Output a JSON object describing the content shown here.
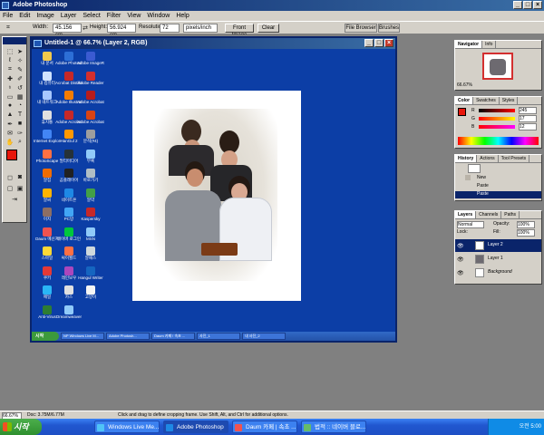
{
  "app": {
    "title": "Adobe Photoshop"
  },
  "menu": [
    "File",
    "Edit",
    "Image",
    "Layer",
    "Select",
    "Filter",
    "View",
    "Window",
    "Help"
  ],
  "options": {
    "width_label": "Width:",
    "width_value": "45.156 cm",
    "height_label": "Height:",
    "height_value": "56.924 cm",
    "resolution_label": "Resolution:",
    "resolution_value": "72",
    "units_value": "pixels/inch",
    "front_image_label": "Front Image",
    "clear_label": "Clear",
    "file_browser_label": "File Browser",
    "brushes_label": "Brushes"
  },
  "document": {
    "title": "Untitled-1 @ 66.7% (Layer 2, RGB)",
    "desktop_icons": [
      {
        "label": "내 문서",
        "color": "#f2c94c"
      },
      {
        "label": "Adobe Photosh",
        "color": "#2d6fd6"
      },
      {
        "label": "Adobe ImageR",
        "color": "#3b5bd1"
      },
      {
        "label": "내 컴퓨터",
        "color": "#cfe2ff"
      },
      {
        "label": "Acrobat Distiller",
        "color": "#c62828"
      },
      {
        "label": "Adobe Reader",
        "color": "#d32f2f"
      },
      {
        "label": "내 네트워크",
        "color": "#a7c7ff"
      },
      {
        "label": "Adobe Illustrat",
        "color": "#f57c00"
      },
      {
        "label": "Adobe Acrobat",
        "color": "#b71c1c"
      },
      {
        "label": "휴지통",
        "color": "#e0e0e0"
      },
      {
        "label": "Adobe Acrobat",
        "color": "#c62828"
      },
      {
        "label": "Adobe Acrobat",
        "color": "#d84315"
      },
      {
        "label": "Internet Explorer",
        "color": "#4285f4"
      },
      {
        "label": "HanGul 2",
        "color": "#ff9800"
      },
      {
        "label": "분석(#4)",
        "color": "#9e9e9e"
      },
      {
        "label": "PhotoScape",
        "color": "#ff7043"
      },
      {
        "label": "멀티미디어",
        "color": "#263238"
      },
      {
        "label": "부록",
        "color": "#90caf9"
      },
      {
        "label": "알집",
        "color": "#ef6c00"
      },
      {
        "label": "곰플레이어",
        "color": "#212121"
      },
      {
        "label": "바로가기",
        "color": "#b0bec5"
      },
      {
        "label": "알씨",
        "color": "#ffb300"
      },
      {
        "label": "네이트온",
        "color": "#1e88e5"
      },
      {
        "label": "알약",
        "color": "#43a047"
      },
      {
        "label": "이지",
        "color": "#8d6e63"
      },
      {
        "label": "PC방",
        "color": "#42a5f5"
      },
      {
        "label": "Kaspersky",
        "color": "#c62828"
      },
      {
        "label": "Daum 메신저",
        "color": "#ef5350"
      },
      {
        "label": "네이버 로그인",
        "color": "#00c73c"
      },
      {
        "label": "MSN",
        "color": "#90caf9"
      },
      {
        "label": "스마일",
        "color": "#fdd835"
      },
      {
        "label": "싸이월드",
        "color": "#ff7043"
      },
      {
        "label": "알패스",
        "color": "#cfd8dc"
      },
      {
        "label": "쿠키",
        "color": "#e53935"
      },
      {
        "label": "레인보우",
        "color": "#ab47bc"
      },
      {
        "label": "Hangul Writer",
        "color": "#1565c0"
      },
      {
        "label": "메일",
        "color": "#29b6f6"
      },
      {
        "label": "카스",
        "color": "#e0e0e0"
      },
      {
        "label": "고양이",
        "color": "#f5f5f5"
      },
      {
        "label": "Anti-Virus",
        "color": "#2e7d32"
      },
      {
        "label": "Dreamweaver",
        "color": "#90caf9"
      }
    ],
    "inner_taskbar": {
      "start_label": "시작",
      "items": [
        "NP Windows Live M...",
        "Adobe Photosh...",
        "Daum 카페 ! 속초 ...",
        "사진_1",
        "내 사진_2"
      ]
    }
  },
  "panels": {
    "navigator": {
      "tabs": [
        "Navigator",
        "Info"
      ],
      "zoom": "66.67%"
    },
    "color": {
      "tabs": [
        "Color",
        "Swatches",
        "Styles"
      ],
      "r": "245",
      "g": "17",
      "b": "12"
    },
    "history": {
      "tabs": [
        "History",
        "Actions",
        "Tool Presets"
      ],
      "items": [
        "",
        "New",
        "Paste",
        "Paste"
      ]
    },
    "layers": {
      "tabs": [
        "Layers",
        "Channels",
        "Paths"
      ],
      "blend_mode": "Normal",
      "opacity_label": "Opacity:",
      "opacity_value": "100%",
      "fill_label": "Fill:",
      "fill_value": "100%",
      "lock_label": "Lock:",
      "items": [
        "Layer 2",
        "Layer 1",
        "Background"
      ]
    }
  },
  "status": {
    "zoom": "66.67%",
    "doc": "Doc: 3.75M/6.77M",
    "hint": "Click and drag to define cropping frame. Use Shift, Alt, and Ctrl for additional options."
  },
  "taskbar": {
    "start_label": "시작",
    "items": [
      {
        "label": "Windows Live Me...",
        "color": "#4fc3f7",
        "active": false
      },
      {
        "label": "Adobe Photoshop",
        "color": "#1e88e5",
        "active": true
      },
      {
        "label": "Daum 카페 | 속초 ...",
        "color": "#ef5350",
        "active": false
      },
      {
        "label": "법적 :: 네이버 블로...",
        "color": "#66bb6a",
        "active": false
      }
    ],
    "clock": "오전 5:00"
  },
  "colors": {
    "foreground": "#e8170c",
    "background": "#ffffff",
    "title_active": "#0a246a"
  }
}
